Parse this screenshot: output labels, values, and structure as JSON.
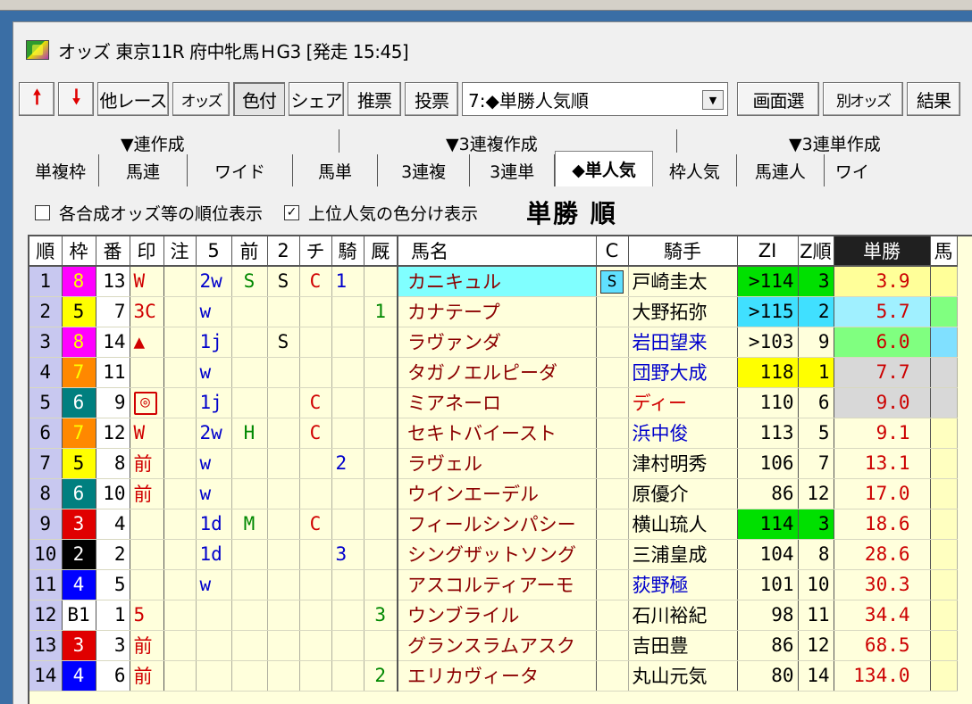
{
  "window": {
    "title": "オッズ 東京11R 府中牝馬ＨG3 [発走 15:45]"
  },
  "toolbar": {
    "up_arrow": "🠕",
    "down_arrow": "🠗",
    "buttons": [
      "他レース",
      "オッズ",
      "色付",
      "シェア",
      "推票",
      "投票"
    ],
    "select_value": "7:◆単勝人気順",
    "right_buttons": [
      "画面選",
      "別オッズ",
      "結果"
    ]
  },
  "sections": [
    "▼連作成",
    "▼3連複作成",
    "▼3連単作成"
  ],
  "tabs": [
    "単複枠",
    "馬連",
    "ワイド",
    "馬単",
    "3連複",
    "3連単",
    "◆単人気",
    "枠人気",
    "馬連人",
    "ワイ"
  ],
  "options": {
    "rank_display": "各合成オッズ等の順位表示",
    "color_display": "上位人気の色分け表示",
    "sort_title": "単勝 順"
  },
  "columns": [
    "順",
    "枠",
    "番",
    "印",
    "注",
    "5",
    "前",
    "2",
    "チ",
    "騎",
    "厩",
    "馬名",
    "C",
    "騎手",
    "ZI",
    "Z順",
    "単勝",
    "馬"
  ],
  "colors": {
    "waku": {
      "1": "#ffffff",
      "2": "#000000",
      "3": "#e00000",
      "4": "#0000ff",
      "5": "#ffff00",
      "6": "#007f7f",
      "7": "#ff8800",
      "8": "#ff00ff"
    },
    "zi_green": "#00e000",
    "zi_cyan": "#40e0ff",
    "zi_yellow": "#ffff00"
  },
  "rows": [
    {
      "rank": "1",
      "waku": "8",
      "waku_color": "#ff00ff",
      "waku_text": "#ffff00",
      "uma": "13",
      "mark": "W",
      "note": "",
      "c5": "2w",
      "mae": "S",
      "c2": "S",
      "chi": "C",
      "kishu": "1",
      "kyu": "",
      "name": "カニキュル",
      "c": "S",
      "jockey": "戸崎圭太",
      "jcolor": "#000",
      "zi": ">114",
      "zi_bg": "#00e000",
      "zjun": "3",
      "zjun_bg": "#00e000",
      "odds": "3.9",
      "odds_bg": "#ffff99",
      "extra_bg": "#ffff99"
    },
    {
      "rank": "2",
      "waku": "5",
      "waku_color": "#ffff00",
      "waku_text": "#000",
      "uma": "7",
      "mark": "3C",
      "note": "",
      "c5": "w",
      "mae": "",
      "c2": "",
      "chi": "",
      "kishu": "",
      "kyu": "1",
      "name": "カナテープ",
      "c": "",
      "jockey": "大野拓弥",
      "jcolor": "#000",
      "zi": ">115",
      "zi_bg": "#40e0ff",
      "zjun": "2",
      "zjun_bg": "#40e0ff",
      "odds": "5.7",
      "odds_bg": "#a0f0ff",
      "extra_bg": "#80ff80"
    },
    {
      "rank": "3",
      "waku": "8",
      "waku_color": "#ff00ff",
      "waku_text": "#ffff00",
      "uma": "14",
      "mark": "▲",
      "note": "",
      "c5": "1j",
      "mae": "",
      "c2": "S",
      "chi": "",
      "kishu": "",
      "kyu": "",
      "name": "ラヴァンダ",
      "c": "",
      "jockey": "岩田望来",
      "jcolor": "#0000cc",
      "zi": ">103",
      "zi_bg": "",
      "zjun": "9",
      "zjun_bg": "",
      "odds": "6.0",
      "odds_bg": "#80ff80",
      "extra_bg": "#80e0ff"
    },
    {
      "rank": "4",
      "waku": "7",
      "waku_color": "#ff8800",
      "waku_text": "#ffff00",
      "uma": "11",
      "mark": "",
      "note": "",
      "c5": "w",
      "mae": "",
      "c2": "",
      "chi": "",
      "kishu": "",
      "kyu": "",
      "name": "タガノエルピーダ",
      "c": "",
      "jockey": "団野大成",
      "jcolor": "#0000cc",
      "zi": "118",
      "zi_bg": "#ffff00",
      "zjun": "1",
      "zjun_bg": "#ffff00",
      "odds": "7.7",
      "odds_bg": "#d8d8d8",
      "extra_bg": "#d8d8d8"
    },
    {
      "rank": "5",
      "waku": "6",
      "waku_color": "#007f7f",
      "waku_text": "#fff",
      "uma": "9",
      "mark": "◎",
      "note": "",
      "c5": "1j",
      "mae": "",
      "c2": "",
      "chi": "C",
      "kishu": "",
      "kyu": "",
      "name": "ミアネーロ",
      "c": "",
      "jockey": "ディー",
      "jcolor": "#d00000",
      "zi": "110",
      "zi_bg": "",
      "zjun": "6",
      "zjun_bg": "",
      "odds": "9.0",
      "odds_bg": "#d8d8d8",
      "extra_bg": "#d8d8d8"
    },
    {
      "rank": "6",
      "waku": "7",
      "waku_color": "#ff8800",
      "waku_text": "#ffff00",
      "uma": "12",
      "mark": "W",
      "note": "",
      "c5": "2w",
      "mae": "H",
      "c2": "",
      "chi": "C",
      "kishu": "",
      "kyu": "",
      "name": "セキトバイースト",
      "c": "",
      "jockey": "浜中俊",
      "jcolor": "#0000cc",
      "zi": "113",
      "zi_bg": "",
      "zjun": "5",
      "zjun_bg": "",
      "odds": "9.1",
      "odds_bg": "",
      "extra_bg": ""
    },
    {
      "rank": "7",
      "waku": "5",
      "waku_color": "#ffff00",
      "waku_text": "#000",
      "uma": "8",
      "mark": "前",
      "note": "",
      "c5": "w",
      "mae": "",
      "c2": "",
      "chi": "",
      "kishu": "2",
      "kyu": "",
      "name": "ラヴェル",
      "c": "",
      "jockey": "津村明秀",
      "jcolor": "#000",
      "zi": "106",
      "zi_bg": "",
      "zjun": "7",
      "zjun_bg": "",
      "odds": "13.1",
      "odds_bg": "",
      "extra_bg": ""
    },
    {
      "rank": "8",
      "waku": "6",
      "waku_color": "#007f7f",
      "waku_text": "#fff",
      "uma": "10",
      "mark": "前",
      "note": "",
      "c5": "w",
      "mae": "",
      "c2": "",
      "chi": "",
      "kishu": "",
      "kyu": "",
      "name": "ウインエーデル",
      "c": "",
      "jockey": "原優介",
      "jcolor": "#000",
      "zi": "86",
      "zi_bg": "",
      "zjun": "12",
      "zjun_bg": "",
      "odds": "17.0",
      "odds_bg": "",
      "extra_bg": ""
    },
    {
      "rank": "9",
      "waku": "3",
      "waku_color": "#e00000",
      "waku_text": "#fff",
      "uma": "4",
      "mark": "",
      "note": "",
      "c5": "1d",
      "mae": "M",
      "c2": "",
      "chi": "C",
      "kishu": "",
      "kyu": "",
      "name": "フィールシンパシー",
      "c": "",
      "jockey": "横山琉人",
      "jcolor": "#000",
      "zi": "114",
      "zi_bg": "#00e000",
      "zjun": "3",
      "zjun_bg": "#00e000",
      "odds": "18.6",
      "odds_bg": "",
      "extra_bg": ""
    },
    {
      "rank": "10",
      "waku": "2",
      "waku_color": "#000000",
      "waku_text": "#fff",
      "uma": "2",
      "mark": "",
      "note": "",
      "c5": "1d",
      "mae": "",
      "c2": "",
      "chi": "",
      "kishu": "3",
      "kyu": "",
      "name": "シングザットソング",
      "c": "",
      "jockey": "三浦皇成",
      "jcolor": "#000",
      "zi": "104",
      "zi_bg": "",
      "zjun": "8",
      "zjun_bg": "",
      "odds": "28.6",
      "odds_bg": "",
      "extra_bg": ""
    },
    {
      "rank": "11",
      "waku": "4",
      "waku_color": "#0000ff",
      "waku_text": "#fff",
      "uma": "5",
      "mark": "",
      "note": "",
      "c5": "w",
      "mae": "",
      "c2": "",
      "chi": "",
      "kishu": "",
      "kyu": "",
      "name": "アスコルティアーモ",
      "c": "",
      "jockey": "荻野極",
      "jcolor": "#0000cc",
      "zi": "101",
      "zi_bg": "",
      "zjun": "10",
      "zjun_bg": "",
      "odds": "30.3",
      "odds_bg": "",
      "extra_bg": ""
    },
    {
      "rank": "12",
      "waku": "B1",
      "waku_color": "#ffffff",
      "waku_text": "#000",
      "uma": "1",
      "mark": "5",
      "note": "",
      "c5": "",
      "mae": "",
      "c2": "",
      "chi": "",
      "kishu": "",
      "kyu": "3",
      "name": "ウンブライル",
      "c": "",
      "jockey": "石川裕紀",
      "jcolor": "#000",
      "zi": "98",
      "zi_bg": "",
      "zjun": "11",
      "zjun_bg": "",
      "odds": "34.4",
      "odds_bg": "",
      "extra_bg": ""
    },
    {
      "rank": "13",
      "waku": "3",
      "waku_color": "#e00000",
      "waku_text": "#fff",
      "uma": "3",
      "mark": "前",
      "note": "",
      "c5": "",
      "mae": "",
      "c2": "",
      "chi": "",
      "kishu": "",
      "kyu": "",
      "name": "グランスラムアスク",
      "c": "",
      "jockey": "吉田豊",
      "jcolor": "#000",
      "zi": "86",
      "zi_bg": "",
      "zjun": "12",
      "zjun_bg": "",
      "odds": "68.5",
      "odds_bg": "",
      "extra_bg": ""
    },
    {
      "rank": "14",
      "waku": "4",
      "waku_color": "#0000ff",
      "waku_text": "#fff",
      "uma": "6",
      "mark": "前",
      "note": "",
      "c5": "",
      "mae": "",
      "c2": "",
      "chi": "",
      "kishu": "",
      "kyu": "2",
      "name": "エリカヴィータ",
      "c": "",
      "jockey": "丸山元気",
      "jcolor": "#000",
      "zi": "80",
      "zi_bg": "",
      "zjun": "14",
      "zjun_bg": "",
      "odds": "134.0",
      "odds_bg": "",
      "extra_bg": ""
    }
  ]
}
